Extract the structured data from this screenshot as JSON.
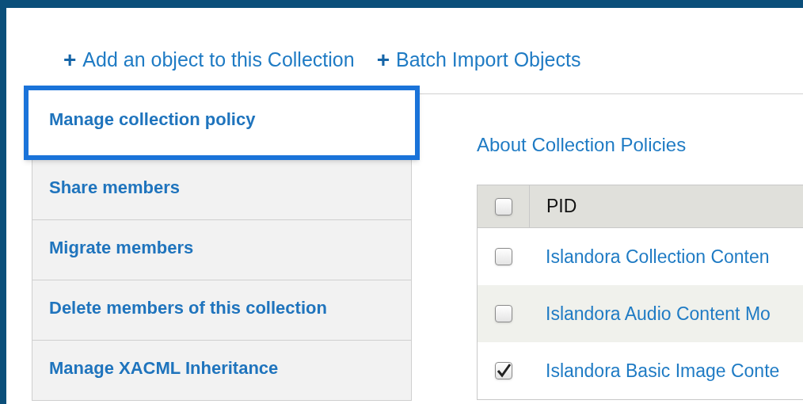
{
  "actions": [
    {
      "icon": "+",
      "label": "Add an object to this Collection"
    },
    {
      "icon": "+",
      "label": "Batch Import Objects"
    }
  ],
  "tabs": [
    {
      "label": "Manage collection policy",
      "selected": true
    },
    {
      "label": "Share members",
      "selected": false
    },
    {
      "label": "Migrate members",
      "selected": false
    },
    {
      "label": "Delete members of this collection",
      "selected": false
    },
    {
      "label": "Manage XACML Inheritance",
      "selected": false
    }
  ],
  "content": {
    "heading": "About Collection Policies",
    "table": {
      "header": {
        "checked": false,
        "label": "PID"
      },
      "rows": [
        {
          "checked": false,
          "label": "Islandora Collection Conten"
        },
        {
          "checked": false,
          "label": "Islandora Audio Content Mo"
        },
        {
          "checked": true,
          "label": "Islandora Basic Image Conte"
        }
      ]
    }
  }
}
